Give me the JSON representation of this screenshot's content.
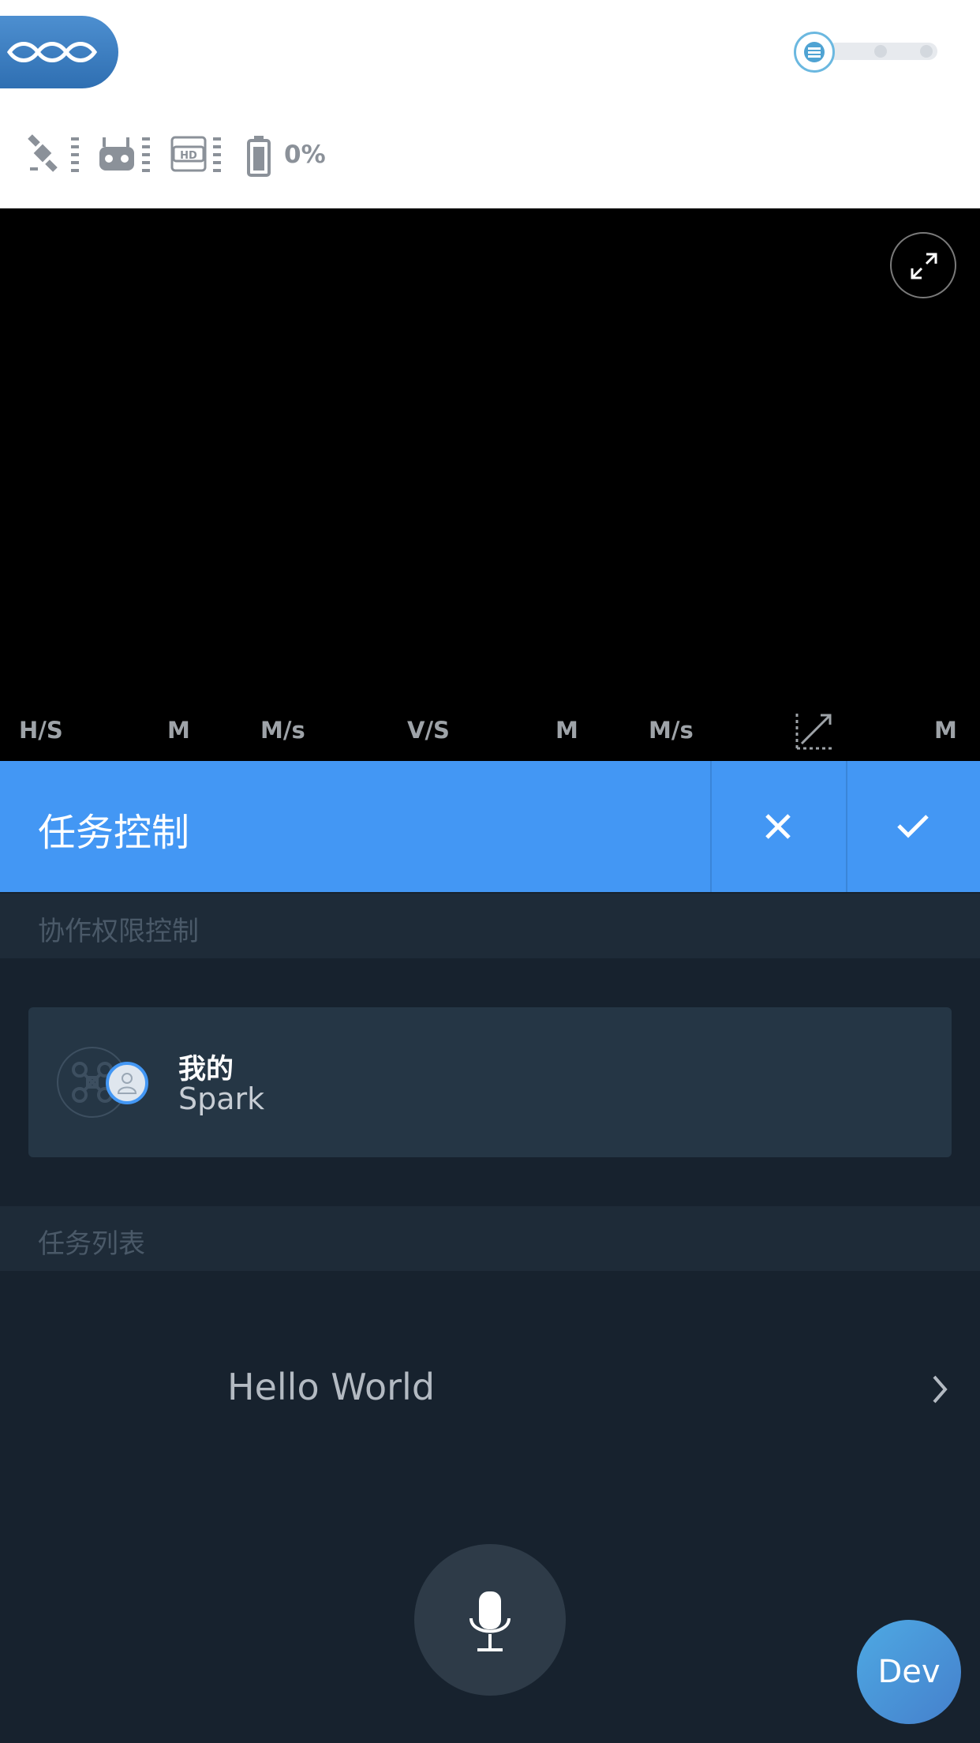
{
  "header": {
    "battery_percent": "0%",
    "status_icons": [
      "satellite-icon",
      "remote-controller-icon",
      "hd-transmission-icon",
      "battery-icon"
    ]
  },
  "video": {
    "expand_icon": "expand-arrows-icon"
  },
  "telemetry": {
    "hs_label": "H/S",
    "hs_unit1": "M",
    "hs_unit2": "M/s",
    "vs_label": "V/S",
    "vs_unit1": "M",
    "vs_unit2": "M/s",
    "dist_unit": "M"
  },
  "task_bar": {
    "title": "任务控制",
    "close_icon": "close-icon",
    "confirm_icon": "check-icon"
  },
  "collab": {
    "section_title": "协作权限控制",
    "owner_label": "我的",
    "device_name": "Spark"
  },
  "tasks": {
    "section_title": "任务列表",
    "items": [
      {
        "label": "Hello World"
      }
    ]
  },
  "footer": {
    "mic_icon": "microphone-icon",
    "dev_label": "Dev"
  },
  "colors": {
    "accent": "#4397f4",
    "panel_bg": "#17222e",
    "card_bg": "#253645"
  }
}
